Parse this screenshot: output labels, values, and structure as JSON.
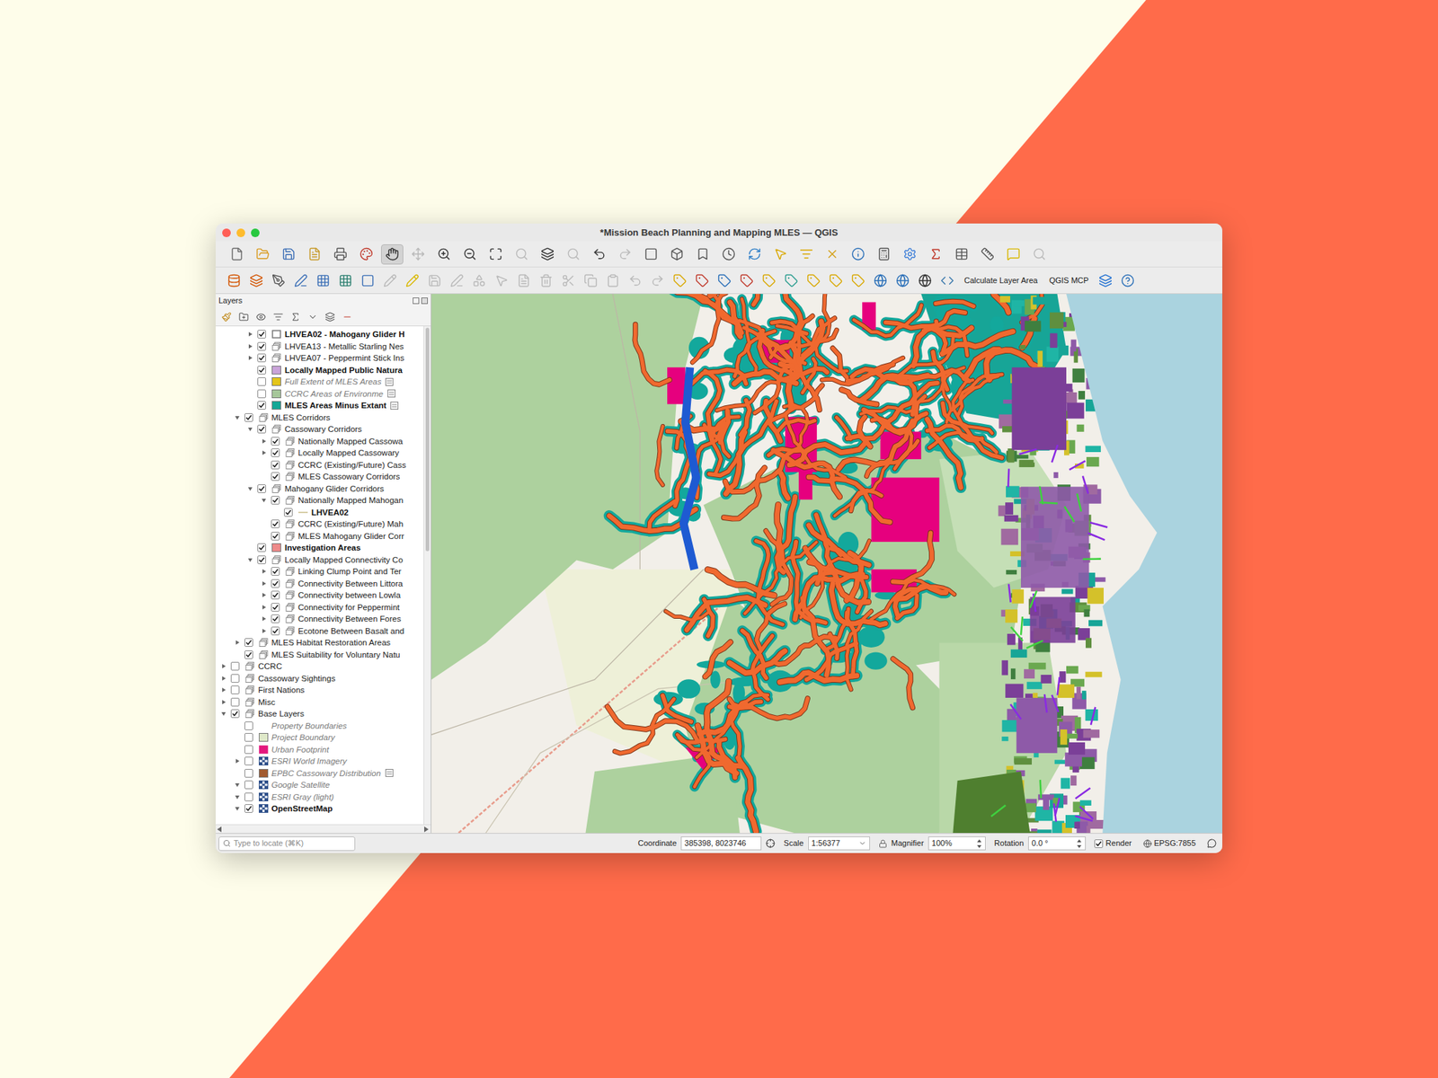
{
  "window": {
    "title": "*Mission Beach Planning and Mapping MLES — QGIS"
  },
  "toolbars": [
    {
      "buttons": [
        {
          "disabled": false,
          "selected": false
        },
        {
          "disabled": false,
          "selected": false
        },
        {
          "disabled": false,
          "selected": false
        },
        {
          "disabled": false,
          "selected": false
        },
        {
          "disabled": false,
          "selected": false
        },
        {
          "disabled": false,
          "selected": false
        },
        {
          "disabled": false,
          "selected": true
        },
        {
          "disabled": true,
          "selected": false
        },
        {
          "disabled": false,
          "selected": false
        },
        {
          "disabled": false,
          "selected": false
        },
        {
          "disabled": false,
          "selected": false
        },
        {
          "disabled": true,
          "selected": false
        },
        {
          "disabled": false,
          "selected": false
        },
        {
          "disabled": true,
          "selected": false
        },
        {
          "disabled": false,
          "selected": false
        },
        {
          "disabled": true,
          "selected": false
        },
        {
          "disabled": false,
          "selected": false
        },
        {
          "disabled": false,
          "selected": false
        },
        {
          "disabled": false,
          "selected": false
        },
        {
          "disabled": false,
          "selected": false
        },
        {
          "disabled": false,
          "selected": false
        },
        {
          "disabled": false,
          "selected": false
        },
        {
          "disabled": false,
          "selected": false
        },
        {
          "disabled": false,
          "selected": false
        },
        {
          "disabled": false,
          "selected": false
        },
        {
          "disabled": false,
          "selected": false
        },
        {
          "disabled": false,
          "selected": false
        },
        {
          "disabled": false,
          "selected": false
        },
        {
          "disabled": false,
          "selected": false
        },
        {
          "disabled": false,
          "selected": false
        },
        {
          "disabled": false,
          "selected": false
        },
        {
          "disabled": true,
          "selected": false
        }
      ]
    },
    {
      "buttons": [
        {
          "kind": "icon",
          "disabled": false
        },
        {
          "kind": "icon",
          "disabled": false
        },
        {
          "kind": "icon",
          "disabled": false
        },
        {
          "kind": "icon",
          "disabled": false
        },
        {
          "kind": "icon",
          "disabled": false
        },
        {
          "kind": "icon",
          "disabled": false
        },
        {
          "kind": "icon",
          "disabled": false
        },
        {
          "kind": "icon",
          "disabled": true
        },
        {
          "kind": "icon",
          "disabled": false
        },
        {
          "kind": "icon",
          "disabled": true
        },
        {
          "kind": "icon",
          "disabled": true
        },
        {
          "kind": "icon",
          "disabled": true
        },
        {
          "kind": "icon",
          "disabled": true
        },
        {
          "kind": "icon",
          "disabled": true
        },
        {
          "kind": "icon",
          "disabled": true
        },
        {
          "kind": "icon",
          "disabled": true
        },
        {
          "kind": "icon",
          "disabled": true
        },
        {
          "kind": "icon",
          "disabled": true
        },
        {
          "kind": "icon",
          "disabled": true
        },
        {
          "kind": "icon",
          "disabled": true
        },
        {
          "kind": "icon",
          "disabled": false
        },
        {
          "kind": "icon",
          "disabled": false
        },
        {
          "kind": "icon",
          "disabled": false
        },
        {
          "kind": "icon",
          "disabled": false
        },
        {
          "kind": "icon",
          "disabled": false
        },
        {
          "kind": "icon",
          "disabled": false
        },
        {
          "kind": "icon",
          "disabled": false
        },
        {
          "kind": "icon",
          "disabled": false
        },
        {
          "kind": "icon",
          "disabled": false
        },
        {
          "kind": "icon",
          "disabled": false
        },
        {
          "kind": "icon",
          "disabled": false
        },
        {
          "kind": "icon",
          "disabled": false
        },
        {
          "kind": "icon",
          "disabled": false
        },
        {
          "kind": "text",
          "label": "Calculate Layer Area",
          "disabled": false
        },
        {
          "kind": "text",
          "label": "QGIS MCP",
          "disabled": false
        },
        {
          "kind": "icon",
          "disabled": false
        },
        {
          "kind": "icon",
          "disabled": false
        }
      ]
    }
  ],
  "layers_panel": {
    "title": "Layers",
    "scroll_level": 0.45,
    "items": [
      {
        "label": "LHVEA02 - Mahogany Glider H",
        "depth": 2,
        "expander": "collapsed",
        "checked": true,
        "style": "bold",
        "kind": "outline",
        "color": "#ffffff",
        "indicator": false
      },
      {
        "label": "LHVEA13 - Metallic Starling Nes",
        "depth": 2,
        "expander": "collapsed",
        "checked": true,
        "style": "normal",
        "kind": "group",
        "indicator": false
      },
      {
        "label": "LHVEA07 - Peppermint Stick Ins",
        "depth": 2,
        "expander": "collapsed",
        "checked": true,
        "style": "normal",
        "kind": "group",
        "indicator": false
      },
      {
        "label": "Locally Mapped Public Natura",
        "depth": 2,
        "expander": "none",
        "checked": true,
        "style": "bold",
        "kind": "fill",
        "color": "#c9a3d9",
        "indicator": false
      },
      {
        "label": "Full Extent of MLES Areas",
        "depth": 2,
        "expander": "none",
        "checked": false,
        "style": "italic",
        "kind": "fill",
        "color": "#e3c51b",
        "indicator": true
      },
      {
        "label": "CCRC Areas of Environme",
        "depth": 2,
        "expander": "none",
        "checked": false,
        "style": "italic",
        "kind": "fill",
        "color": "#a6c79a",
        "indicator": true
      },
      {
        "label": "MLES Areas Minus Extant",
        "depth": 2,
        "expander": "none",
        "checked": true,
        "style": "bold",
        "kind": "fill",
        "color": "#14a796",
        "indicator": true
      },
      {
        "label": "MLES Corridors",
        "depth": 1,
        "expander": "expanded",
        "checked": true,
        "style": "normal",
        "kind": "group",
        "indicator": false
      },
      {
        "label": "Cassowary Corridors",
        "depth": 2,
        "expander": "expanded",
        "checked": true,
        "style": "normal",
        "kind": "group",
        "indicator": false
      },
      {
        "label": "Nationally Mapped Cassowa",
        "depth": 3,
        "expander": "collapsed",
        "checked": true,
        "style": "normal",
        "kind": "group",
        "indicator": false
      },
      {
        "label": "Locally Mapped Cassowary",
        "depth": 3,
        "expander": "collapsed",
        "checked": true,
        "style": "normal",
        "kind": "group",
        "indicator": false
      },
      {
        "label": "CCRC (Existing/Future) Cass",
        "depth": 3,
        "expander": "none",
        "checked": true,
        "style": "normal",
        "kind": "group",
        "indicator": false
      },
      {
        "label": "MLES Cassowary Corridors",
        "depth": 3,
        "expander": "none",
        "checked": true,
        "style": "normal",
        "kind": "group",
        "indicator": false
      },
      {
        "label": "Mahogany Glider Corridors",
        "depth": 2,
        "expander": "expanded",
        "checked": true,
        "style": "normal",
        "kind": "group",
        "indicator": false
      },
      {
        "label": "Nationally Mapped Mahogan",
        "depth": 3,
        "expander": "expanded",
        "checked": true,
        "style": "normal",
        "kind": "group",
        "indicator": false
      },
      {
        "label": "LHVEA02",
        "depth": 4,
        "expander": "none",
        "checked": true,
        "style": "bold",
        "kind": "line",
        "color": "#d8cfa8",
        "indicator": false
      },
      {
        "label": "CCRC (Existing/Future) Mah",
        "depth": 3,
        "expander": "none",
        "checked": true,
        "style": "normal",
        "kind": "group",
        "indicator": false
      },
      {
        "label": "MLES Mahogany Glider Corr",
        "depth": 3,
        "expander": "none",
        "checked": true,
        "style": "normal",
        "kind": "group",
        "indicator": false
      },
      {
        "label": "Investigation Areas",
        "depth": 2,
        "expander": "none",
        "checked": true,
        "style": "bold",
        "kind": "fill",
        "color": "#ee8a8a",
        "indicator": false
      },
      {
        "label": "Locally Mapped Connectivity Co",
        "depth": 2,
        "expander": "expanded",
        "checked": true,
        "style": "normal",
        "kind": "group",
        "indicator": false
      },
      {
        "label": "Linking Clump Point and Ter",
        "depth": 3,
        "expander": "collapsed",
        "checked": true,
        "style": "normal",
        "kind": "group",
        "indicator": false
      },
      {
        "label": "Connectivity Between Littora",
        "depth": 3,
        "expander": "collapsed",
        "checked": true,
        "style": "normal",
        "kind": "group",
        "indicator": false
      },
      {
        "label": "Connectivity between Lowla",
        "depth": 3,
        "expander": "collapsed",
        "checked": true,
        "style": "normal",
        "kind": "group",
        "indicator": false
      },
      {
        "label": "Connectivity for Peppermint",
        "depth": 3,
        "expander": "collapsed",
        "checked": true,
        "style": "normal",
        "kind": "group",
        "indicator": false
      },
      {
        "label": "Connectivity Between Fores",
        "depth": 3,
        "expander": "collapsed",
        "checked": true,
        "style": "normal",
        "kind": "group",
        "indicator": false
      },
      {
        "label": "Ecotone Between Basalt and",
        "depth": 3,
        "expander": "collapsed",
        "checked": true,
        "style": "normal",
        "kind": "group",
        "indicator": false
      },
      {
        "label": "MLES Habitat Restoration Areas",
        "depth": 1,
        "expander": "collapsed",
        "checked": true,
        "style": "normal",
        "kind": "group",
        "indicator": false
      },
      {
        "label": "MLES Suitability for Voluntary Natu",
        "depth": 1,
        "expander": "none",
        "checked": true,
        "style": "normal",
        "kind": "group",
        "indicator": false
      },
      {
        "label": "CCRC",
        "depth": 0,
        "expander": "collapsed",
        "checked": false,
        "style": "normal",
        "kind": "group",
        "indicator": false
      },
      {
        "label": "Cassowary Sightings",
        "depth": 0,
        "expander": "collapsed",
        "checked": false,
        "style": "normal",
        "kind": "group",
        "indicator": false
      },
      {
        "label": "First Nations",
        "depth": 0,
        "expander": "collapsed",
        "checked": false,
        "style": "normal",
        "kind": "group",
        "indicator": false
      },
      {
        "label": "Misc",
        "depth": 0,
        "expander": "collapsed",
        "checked": false,
        "style": "normal",
        "kind": "group",
        "indicator": false
      },
      {
        "label": "Base Layers",
        "depth": 0,
        "expander": "expanded",
        "checked": true,
        "style": "normal",
        "kind": "group",
        "indicator": false
      },
      {
        "label": "Property Boundaries",
        "depth": 1,
        "expander": "none",
        "checked": false,
        "style": "italic",
        "kind": "none",
        "indicator": false
      },
      {
        "label": "Project Boundary",
        "depth": 1,
        "expander": "none",
        "checked": false,
        "style": "italic",
        "kind": "fill",
        "color": "#dfe9c9",
        "indicator": false
      },
      {
        "label": "Urban Footprint",
        "depth": 1,
        "expander": "none",
        "checked": false,
        "style": "italic",
        "kind": "outline",
        "color": "#e3177d",
        "indicator": false
      },
      {
        "label": "ESRI World Imagery",
        "depth": 1,
        "expander": "collapsed",
        "checked": false,
        "style": "italic",
        "kind": "raster",
        "indicator": false
      },
      {
        "label": "EPBC Cassowary Distribution",
        "depth": 1,
        "expander": "none",
        "checked": false,
        "style": "italic",
        "kind": "fill",
        "color": "#a15a2f",
        "indicator": true
      },
      {
        "label": "Google Satellite",
        "depth": 1,
        "expander": "expanded",
        "checked": false,
        "style": "italic",
        "kind": "raster",
        "indicator": false
      },
      {
        "label": "ESRI Gray (light)",
        "depth": 1,
        "expander": "expanded",
        "checked": false,
        "style": "italic",
        "kind": "raster",
        "indicator": false
      },
      {
        "label": "OpenStreetMap",
        "depth": 1,
        "expander": "expanded",
        "checked": true,
        "style": "bold",
        "kind": "raster",
        "indicator": false
      }
    ]
  },
  "status_bar": {
    "search_placeholder": "Type to locate (⌘K)",
    "coordinate_label": "Coordinate",
    "coordinate": "385398, 8023746",
    "scale_label": "Scale",
    "scale": "1:56377",
    "magnifier_label": "Magnifier",
    "magnifier": "100%",
    "rotation_label": "Rotation",
    "rotation": "0.0 °",
    "render_label": "Render",
    "render_checked": true,
    "crs": "EPSG:7855"
  }
}
